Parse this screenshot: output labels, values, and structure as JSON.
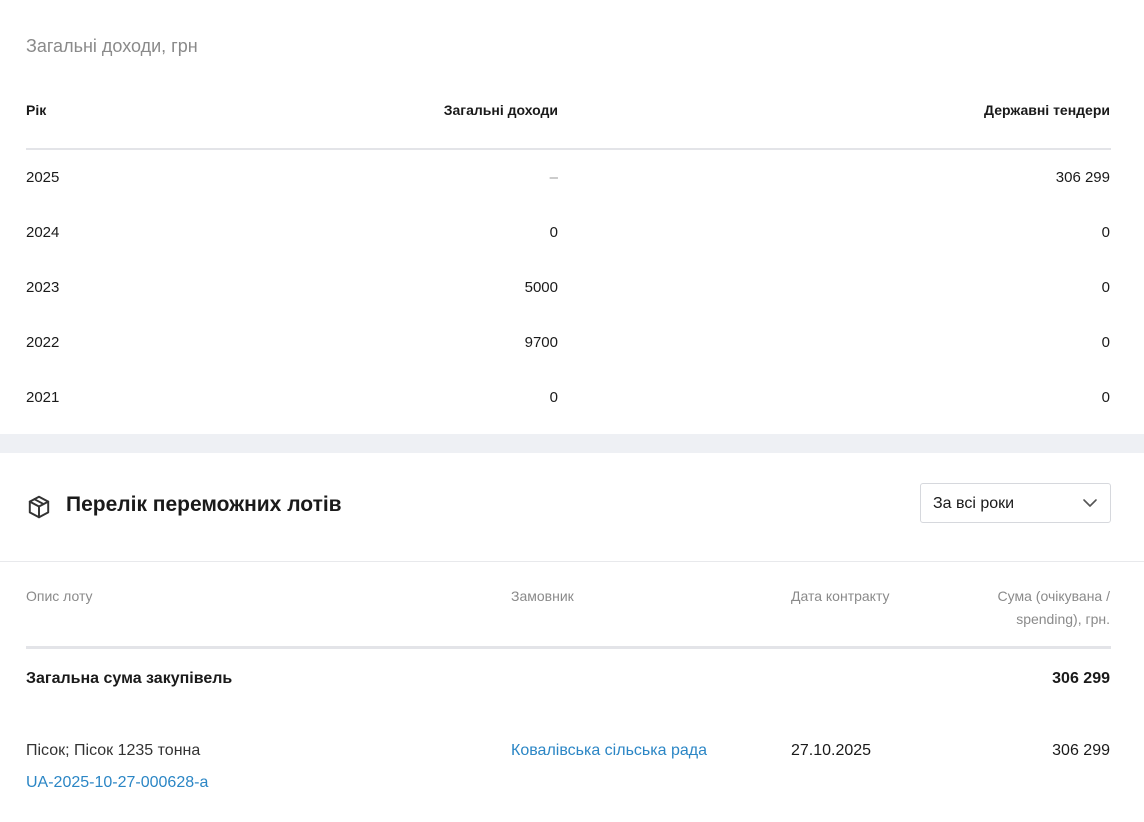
{
  "income": {
    "title": "Загальні доходи, грн",
    "headers": {
      "year": "Рік",
      "total": "Загальні доходи",
      "tenders": "Державні тендери"
    },
    "rows": [
      {
        "year": "2025",
        "total": "–",
        "tenders": "306 299"
      },
      {
        "year": "2024",
        "total": "0",
        "tenders": "0"
      },
      {
        "year": "2023",
        "total": "5000",
        "tenders": "0"
      },
      {
        "year": "2022",
        "total": "9700",
        "tenders": "0"
      },
      {
        "year": "2021",
        "total": "0",
        "tenders": "0"
      }
    ]
  },
  "lots": {
    "icon": "package-icon",
    "title": "Перелік переможних лотів",
    "year_filter": {
      "selected": "За всі роки",
      "icon": "chevron-down-icon"
    },
    "headers": {
      "description": "Опис лоту",
      "customer": "Замовник",
      "date": "Дата контракту",
      "sum_line1": "Сума (очікувана /",
      "sum_line2": "spending), грн."
    },
    "total": {
      "label": "Загальна сума закупівель",
      "value": "306 299"
    },
    "items": [
      {
        "description": "Пісок; Пісок 1235 тонна",
        "id": "UA-2025-10-27-000628-a",
        "customer": "Ковалівська сільська рада",
        "date": "27.10.2025",
        "sum": "306 299"
      }
    ]
  },
  "colors": {
    "link": "#2b86c5",
    "muted": "#8a8a8a",
    "band": "#eef0f4"
  }
}
